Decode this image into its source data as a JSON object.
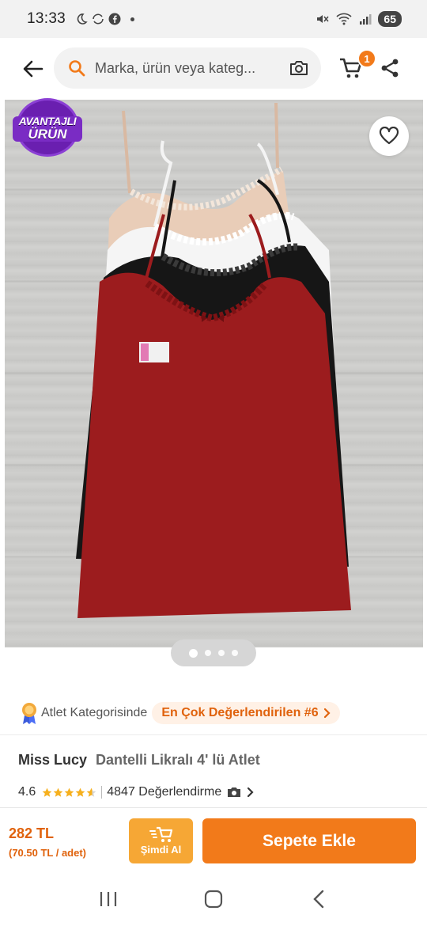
{
  "status_bar": {
    "time": "13:33",
    "battery": "65",
    "icons": [
      "moon-icon",
      "sync-icon",
      "facebook-icon",
      "mute-icon",
      "wifi-icon",
      "signal-icon"
    ]
  },
  "header": {
    "search_placeholder": "Marka, ürün veya kateg...",
    "cart_count": "1",
    "icons": [
      "back-arrow-icon",
      "search-icon",
      "camera-icon",
      "cart-icon",
      "share-icon"
    ]
  },
  "gallery": {
    "badge_line1": "AVANTAJLI",
    "badge_line2": "ÜRÜN",
    "page_count": 4,
    "active_page": 1,
    "colors": {
      "beige": "#e9cdb8",
      "white": "#f5f5f5",
      "black": "#161616",
      "red": "#9c1c1e"
    }
  },
  "category": {
    "prefix": "Atlet Kategorisinde",
    "rank_label": "En Çok Değerlendirilen #6"
  },
  "product": {
    "brand": "Miss Lucy",
    "name": "Dantelli Likralı 4' lü Atlet",
    "rating": "4.6",
    "rating_value": 4.6,
    "reviews": "4847 Değerlendirme"
  },
  "purchase": {
    "price": "282 TL",
    "unit_price": "(70.50 TL / adet)",
    "buy_now_label": "Şimdi Al",
    "add_to_cart_label": "Sepete Ekle"
  },
  "theme": {
    "accent": "#f27a1a",
    "accent_light": "#f6a735",
    "badge_purple": "#6a1fb0"
  }
}
